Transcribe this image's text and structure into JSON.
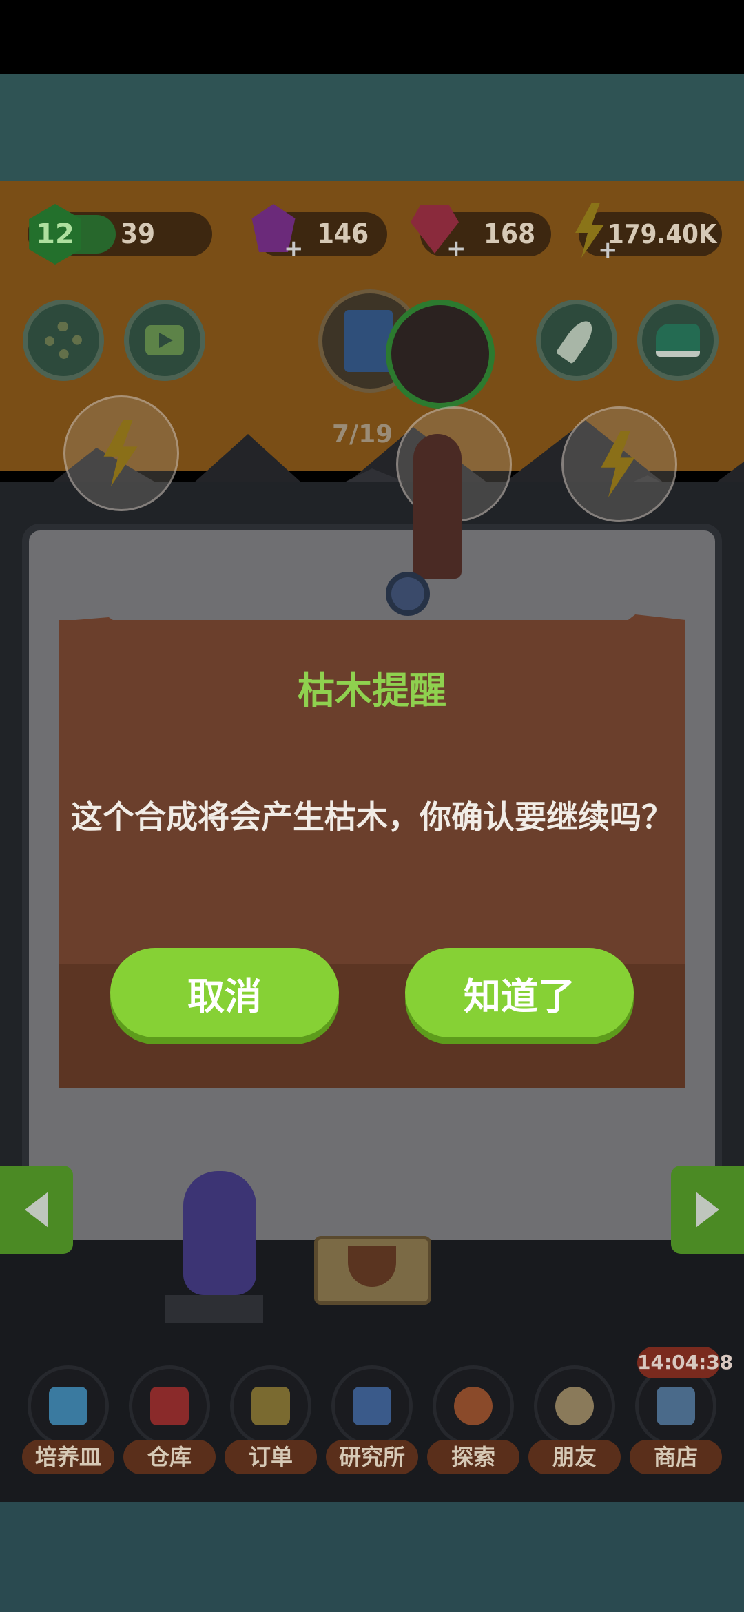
{
  "resources": {
    "level": "12",
    "level_value": "39",
    "purple_gems": "146",
    "red_gems": "168",
    "energy": "179.40K"
  },
  "progress": {
    "text": "7/19"
  },
  "dialog": {
    "title": "枯木提醒",
    "message": "这个合成将会产生枯木，你确认要继续吗？",
    "cancel_label": "取消",
    "ok_label": "知道了"
  },
  "nav": {
    "items": [
      {
        "label": "培养皿",
        "icon": "petri-dish-icon",
        "color": "#3a7aa0"
      },
      {
        "label": "仓库",
        "icon": "warehouse-icon",
        "color": "#8a2a2a"
      },
      {
        "label": "订单",
        "icon": "order-scroll-icon",
        "color": "#7a6a30"
      },
      {
        "label": "研究所",
        "icon": "lab-flask-icon",
        "color": "#3a5a8a"
      },
      {
        "label": "探索",
        "icon": "hot-air-balloon-icon",
        "color": "#8a4a2a"
      },
      {
        "label": "朋友",
        "icon": "friends-icon",
        "color": "#8a7a5a"
      },
      {
        "label": "商店",
        "icon": "shop-icon",
        "color": "#4a6a8a"
      }
    ],
    "timer": "14:04:38"
  },
  "colors": {
    "dialog_bg": "#6b3f2c",
    "title_green": "#8fd14f",
    "button_green": "#86d135",
    "sky_orange": "#7a4e16"
  }
}
